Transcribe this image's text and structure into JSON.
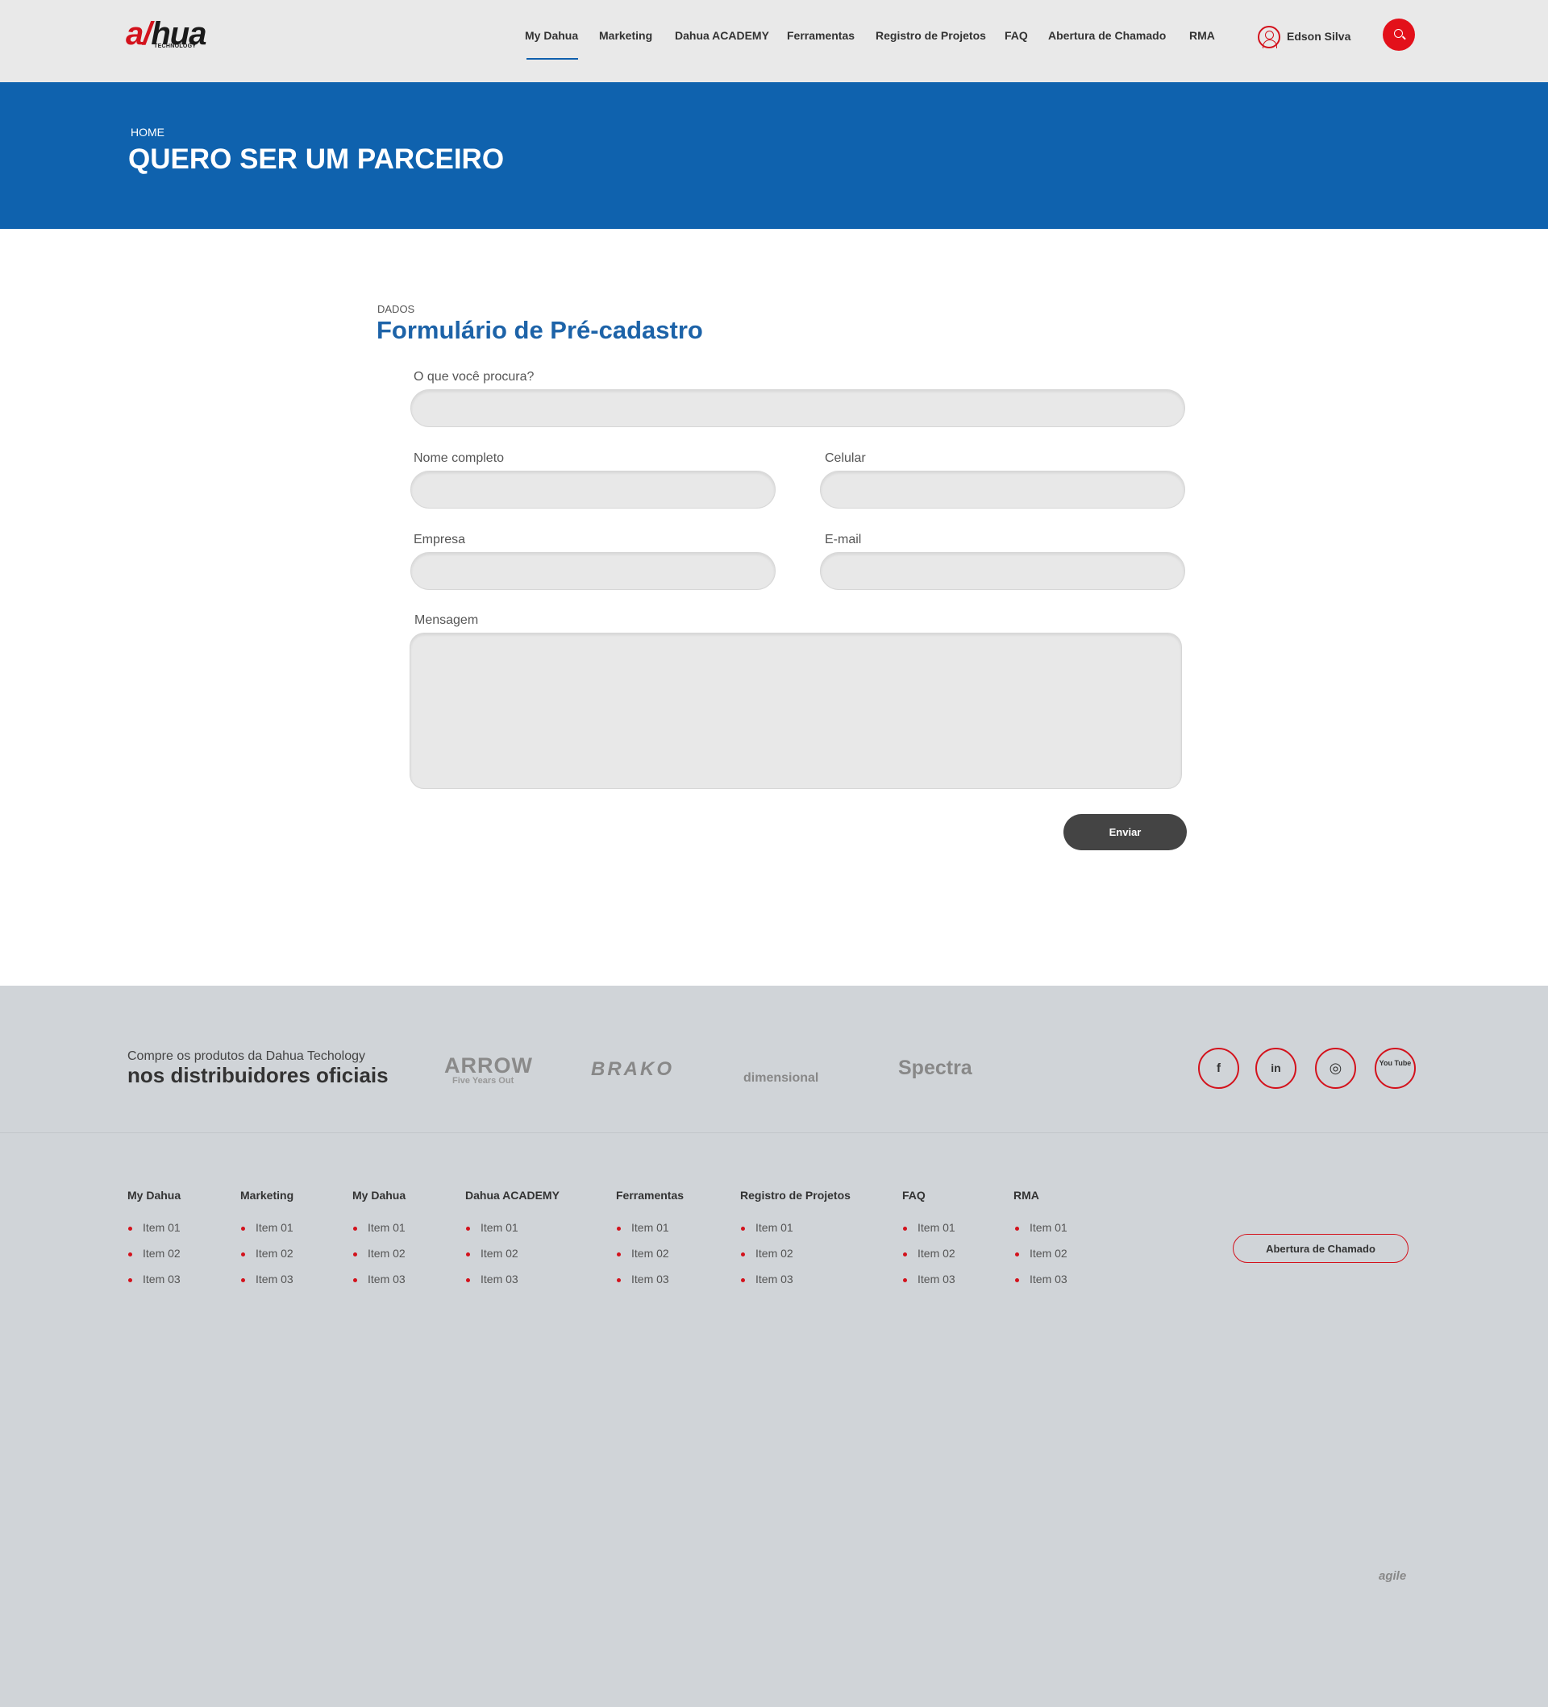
{
  "header": {
    "logo_text": "alhua",
    "logo_sub": "TECHNOLOGY",
    "nav": [
      "My Dahua",
      "Marketing",
      "Dahua ACADEMY",
      "Ferramentas",
      "Registro de Projetos",
      "FAQ",
      "Abertura de Chamado",
      "RMA"
    ],
    "active_nav": "My Dahua",
    "user_name": "Edson Silva"
  },
  "banner": {
    "breadcrumb": "HOME",
    "title": "QUERO SER UM PARCEIRO"
  },
  "form": {
    "overline": "DADOS",
    "title": "Formulário de Pré-cadastro",
    "fields": {
      "search": {
        "label": "O que você procura?",
        "value": ""
      },
      "name": {
        "label": "Nome completo",
        "value": ""
      },
      "phone": {
        "label": "Celular",
        "value": ""
      },
      "company": {
        "label": "Empresa",
        "value": ""
      },
      "email": {
        "label": "E-mail",
        "value": ""
      },
      "message": {
        "label": "Mensagem",
        "value": ""
      }
    },
    "submit_label": "Enviar"
  },
  "distributors": {
    "small_text": "Compre os produtos da Dahua Techology",
    "big_text": "nos distribuidores oficiais",
    "partners": [
      "ARROW",
      "Five Years Out",
      "BRAKO",
      "dimensional",
      "Spectra"
    ],
    "social": [
      "f",
      "in",
      "◎",
      "You Tube"
    ]
  },
  "footer": {
    "columns": [
      {
        "title": "My Dahua",
        "items": [
          "Item 01",
          "Item 02",
          "Item 03"
        ]
      },
      {
        "title": "Marketing",
        "items": [
          "Item 01",
          "Item 02",
          "Item 03"
        ]
      },
      {
        "title": "My Dahua",
        "items": [
          "Item 01",
          "Item 02",
          "Item 03"
        ]
      },
      {
        "title": "Dahua ACADEMY",
        "items": [
          "Item 01",
          "Item 02",
          "Item 03"
        ]
      },
      {
        "title": "Ferramentas",
        "items": [
          "Item 01",
          "Item 02",
          "Item 03"
        ]
      },
      {
        "title": "Registro de Projetos",
        "items": [
          "Item 01",
          "Item 02",
          "Item 03"
        ]
      },
      {
        "title": "FAQ",
        "items": [
          "Item 01",
          "Item 02",
          "Item 03"
        ]
      },
      {
        "title": "RMA",
        "items": [
          "Item 01",
          "Item 02",
          "Item 03"
        ]
      }
    ],
    "ticket_label": "Abertura de Chamado",
    "credit": "agile"
  },
  "colors": {
    "brand_red": "#d3121c",
    "brand_blue": "#0f62ae",
    "title_blue": "#1d63a8",
    "button_dark": "#444444"
  }
}
